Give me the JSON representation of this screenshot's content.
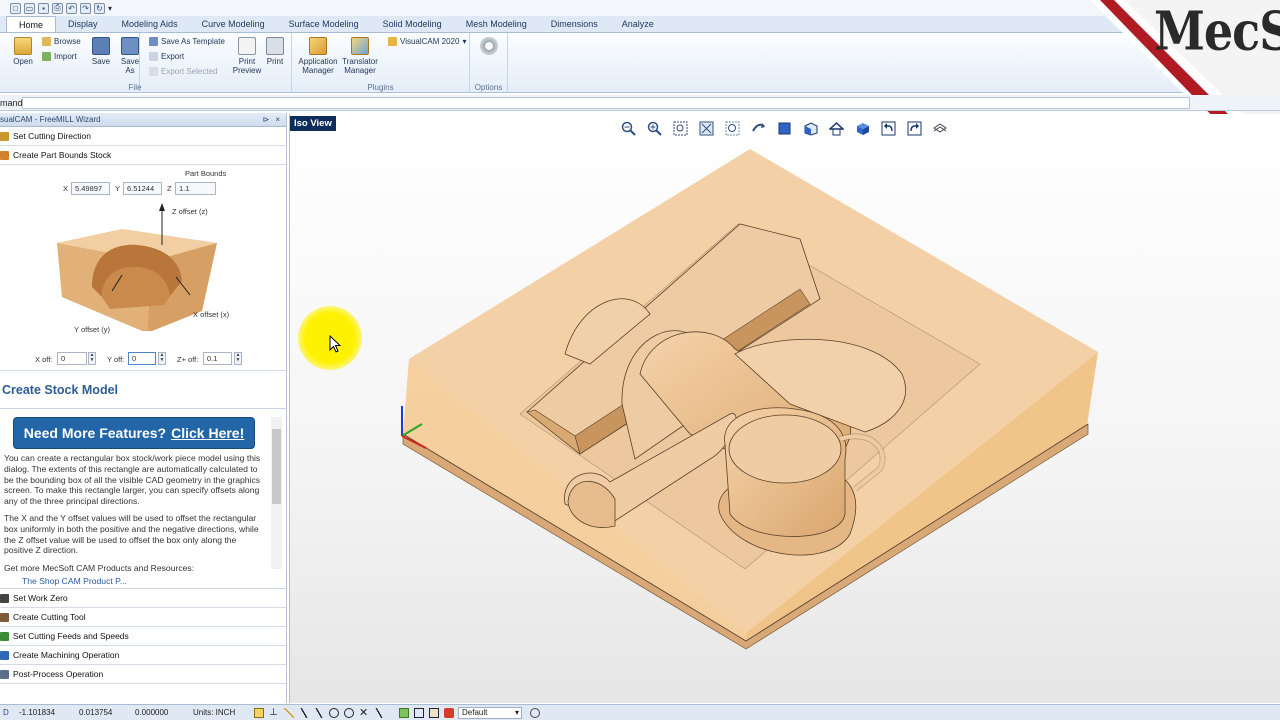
{
  "ribbon_tabs": [
    "Home",
    "Display",
    "Modeling Aids",
    "Curve Modeling",
    "Surface Modeling",
    "Solid Modeling",
    "Mesh Modeling",
    "Dimensions",
    "Analyze"
  ],
  "ribbon": {
    "open": "Open",
    "browse": "Browse",
    "import": "Import",
    "save": "Save",
    "save_as": "Save As",
    "save_as_template": "Save As Template",
    "export": "Export",
    "export_selected": "Export Selected",
    "print_preview": "Print Preview",
    "print": "Print",
    "file_group": "File",
    "application_manager": "Application Manager",
    "translator_manager": "Translator Manager",
    "plugins_group": "Plugins",
    "visualcam_2020": "VisualCAM 2020",
    "options_group": "Options"
  },
  "logo": {
    "text": "MecSoft"
  },
  "command": {
    "label": "mand",
    "value": ""
  },
  "panel": {
    "title": "sualCAM - FreeMILL Wizard",
    "pin": "⊳",
    "close": "×",
    "steps_top": [
      "Set Cutting Direction",
      "Create Part Bounds Stock"
    ],
    "part_bounds_label": "Part Bounds",
    "bounds": {
      "x_label": "X",
      "x": "5.49897",
      "y_label": "Y",
      "y": "6.51244",
      "z_label": "Z",
      "z": "1.1"
    },
    "labels": {
      "z_offset": "Z offset (z)",
      "x_offset": "X offset (x)",
      "y_offset": "Y offset (y)"
    },
    "offsets": {
      "x_label": "X off:",
      "x": "0",
      "y_label": "Y off:",
      "y": "0",
      "z_label": "Z+ off:",
      "z": "0.1"
    },
    "create_stock_title": "Create Stock Model",
    "cta": {
      "text": "Need More Features?",
      "link": "Click Here!"
    },
    "help_p1": "You can create a rectangular box stock/work piece model using this dialog. The extents of this rectangle are automatically calculated to be the bounding box of all the visible CAD geometry in the graphics screen. To make this rectangle larger, you can specify offsets along any of the three principal directions.",
    "help_p2": "The X and the Y offset values will be used to offset the rectangular box uniformly in both the positive and the negative directions, while the Z offset value will be used to offset the box only along the positive Z direction.",
    "help_p3": "Get more MecSoft CAM Products and Resources:",
    "help_p4": "The Shop CAM Product P...",
    "steps_bottom": [
      "Set Work Zero",
      "Create Cutting Tool",
      "Set Cutting Feeds and Speeds",
      "Create Machining Operation",
      "Post-Process Operation"
    ]
  },
  "viewport": {
    "label": "Iso View"
  },
  "status": {
    "x": "-1.101834",
    "y": "0.013754",
    "z": "0.000000",
    "units": "Units: INCH",
    "layer_combo": "Default"
  },
  "colors": {
    "accent": "#2366a8",
    "part": "#f0c99a",
    "stock": "#f3c98e"
  }
}
